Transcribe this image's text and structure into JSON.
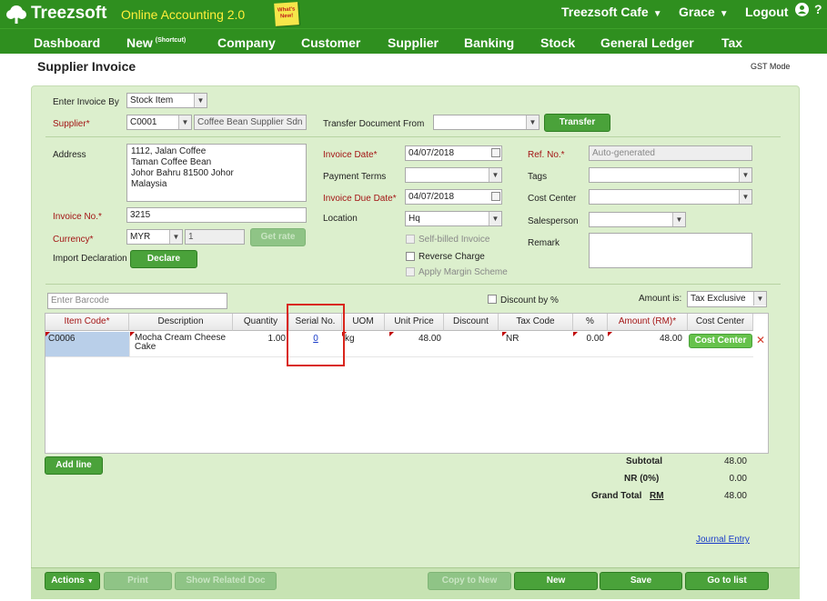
{
  "topbar": {
    "logo_text": "Treezsoft",
    "subtitle": "Online Accounting 2.0",
    "whats_new": "What's New!",
    "company_menu": "Treezsoft Cafe",
    "user_menu": "Grace",
    "logout": "Logout",
    "help": "?"
  },
  "nav": {
    "items": [
      "Dashboard",
      "New",
      "Company",
      "Customer",
      "Supplier",
      "Banking",
      "Stock",
      "General Ledger",
      "Tax"
    ],
    "new_superscript": "(Shortcut)"
  },
  "page": {
    "title": "Supplier Invoice",
    "gst_mode": "GST Mode"
  },
  "form": {
    "enter_invoice_by_label": "Enter Invoice By",
    "enter_invoice_by_value": "Stock Item",
    "supplier_label": "Supplier*",
    "supplier_code": "C0001",
    "supplier_name": "Coffee Bean Supplier Sdn Bhd",
    "transfer_from_label": "Transfer Document From",
    "transfer_from_value": "",
    "transfer_button": "Transfer",
    "address_label": "Address",
    "address_lines": [
      "1112, Jalan Coffee",
      "Taman Coffee Bean",
      "Johor Bahru 81500 Johor",
      "Malaysia"
    ],
    "invoice_date_label": "Invoice Date*",
    "invoice_date": "04/07/2018",
    "payment_terms_label": "Payment Terms",
    "payment_terms_value": "",
    "invoice_due_date_label": "Invoice Due Date*",
    "invoice_due_date": "04/07/2018",
    "location_label": "Location",
    "location_value": "Hq",
    "ref_no_label": "Ref. No.*",
    "ref_no_placeholder": "Auto-generated",
    "tags_label": "Tags",
    "cost_center_label": "Cost Center",
    "salesperson_label": "Salesperson",
    "remark_label": "Remark",
    "invoice_no_label": "Invoice No.*",
    "invoice_no": "3215",
    "currency_label": "Currency*",
    "currency_value": "MYR",
    "exchange_rate": "1",
    "get_rate_button": "Get rate",
    "import_declaration_label": "Import Declaration",
    "declare_button": "Declare",
    "self_billed_label": "Self-billed Invoice",
    "reverse_charge_label": "Reverse Charge",
    "apply_margin_label": "Apply Margin Scheme",
    "barcode_placeholder": "Enter Barcode",
    "discount_by_pct_label": "Discount by %",
    "amount_is_label": "Amount is:",
    "amount_is_value": "Tax Exclusive"
  },
  "grid": {
    "headers": [
      "Item Code*",
      "Description",
      "Quantity",
      "Serial No.",
      "UOM",
      "Unit Price",
      "Discount",
      "Tax Code",
      "%",
      "Amount (RM)*",
      "Cost Center"
    ],
    "rows": [
      {
        "item_code": "C0006",
        "description": "Mocha Cream Cheese Cake",
        "quantity": "1.00",
        "serial_no": "0",
        "uom": "kg",
        "unit_price": "48.00",
        "discount": "",
        "tax_code": "NR",
        "pct": "0.00",
        "amount": "48.00",
        "cost_center_button": "Cost Center",
        "delete_icon": "✕"
      }
    ],
    "add_line_button": "Add line"
  },
  "summary": {
    "subtotal_label": "Subtotal",
    "subtotal": "48.00",
    "tax_label": "NR (0%)",
    "tax": "0.00",
    "grand_total_label": "Grand Total",
    "currency_link": "RM",
    "grand_total": "48.00",
    "journal_entry_link": "Journal Entry"
  },
  "footer": {
    "actions": "Actions",
    "print": "Print",
    "show_related": "Show Related Doc",
    "copy_to_new": "Copy to New",
    "new": "New",
    "save": "Save",
    "go_to_list": "Go to list"
  },
  "colors": {
    "brand_green": "#2f8f1f",
    "panel_bg": "#dcefcd",
    "required_red": "#a31515",
    "highlight_box": "#d9261c",
    "link_blue": "#1a3cc8"
  }
}
